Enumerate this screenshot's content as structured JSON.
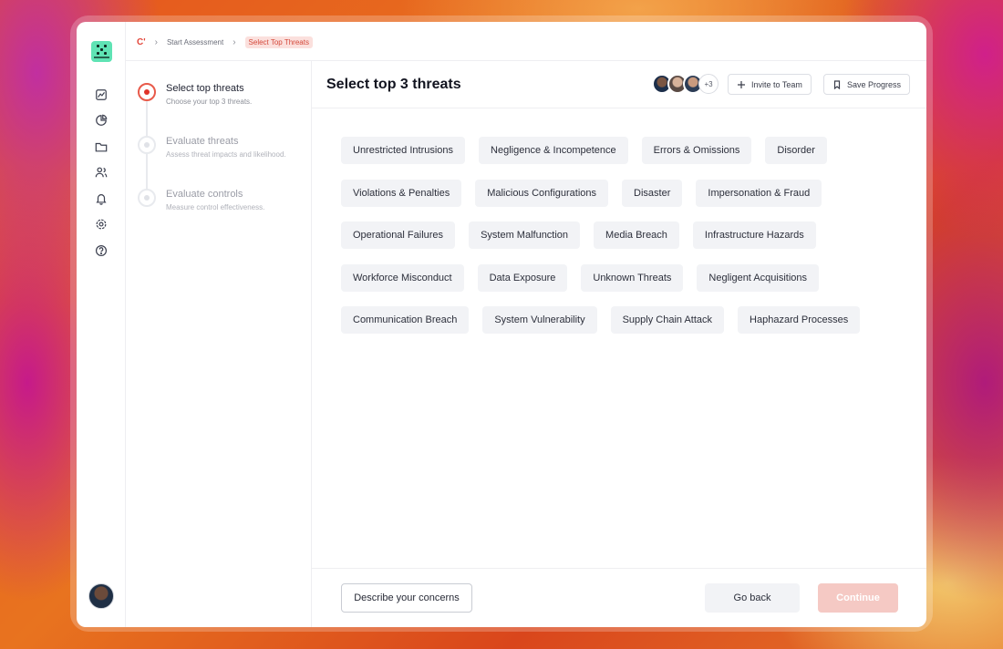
{
  "breadcrumb": {
    "logo": "C'",
    "items": [
      "Start Assessment",
      "Select Top Threats"
    ]
  },
  "steps": [
    {
      "title": "Select top threats",
      "subtitle": "Choose your top 3 threats."
    },
    {
      "title": "Evaluate threats",
      "subtitle": "Assess threat impacts and likelihood."
    },
    {
      "title": "Evaluate controls",
      "subtitle": "Measure control effectiveness."
    }
  ],
  "main": {
    "title": "Select top 3 threats",
    "team_more": "+3",
    "invite_label": "Invite to Team",
    "save_label": "Save Progress"
  },
  "threats": [
    [
      "Unrestricted Intrusions",
      "Negligence & Incompetence",
      "Errors & Omissions",
      "Disorder"
    ],
    [
      "Violations & Penalties",
      "Malicious Configurations",
      "Disaster",
      "Impersonation & Fraud"
    ],
    [
      "Operational Failures",
      "System Malfunction",
      "Media Breach",
      "Infrastructure Hazards"
    ],
    [
      "Workforce Misconduct",
      "Data Exposure",
      "Unknown Threats",
      "Negligent Acquisitions"
    ],
    [
      "Communication Breach",
      "System Vulnerability",
      "Supply Chain Attack",
      "Haphazard Processes"
    ]
  ],
  "footer": {
    "describe_label": "Describe your concerns",
    "back_label": "Go back",
    "continue_label": "Continue"
  },
  "colors": {
    "accent": "#e0342a",
    "logo": "#5fe3b4",
    "continue_disabled": "#f5c9c4"
  },
  "icons": [
    "app-logo-icon",
    "chart-icon",
    "pie-chart-icon",
    "folder-icon",
    "users-icon",
    "bell-icon",
    "gear-icon",
    "help-icon",
    "plus-icon",
    "bookmark-icon",
    "chevron-right-icon"
  ]
}
